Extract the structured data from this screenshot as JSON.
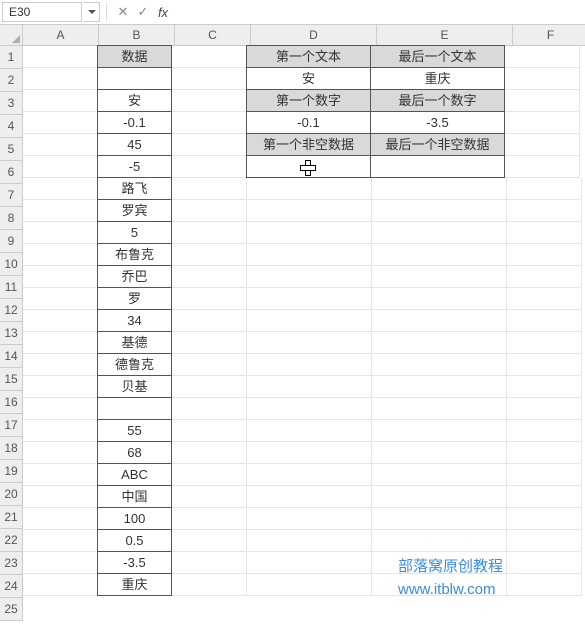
{
  "name_box": "E30",
  "formula_value": "",
  "columns": [
    "A",
    "B",
    "C",
    "D",
    "E",
    "F"
  ],
  "rows_count": 25,
  "col_B_header": "数据",
  "col_B": [
    "",
    "",
    "安",
    "-0.1",
    "45",
    "-5",
    "路飞",
    "罗宾",
    "5",
    "布鲁克",
    "乔巴",
    "罗",
    "34",
    "基德",
    "德鲁克",
    "贝基",
    "",
    "55",
    "68",
    "ABC",
    "中国",
    "100",
    "0.5",
    "-3.5",
    "重庆"
  ],
  "table2": {
    "r1c1": "第一个文本",
    "r1c2": "最后一个文本",
    "r2c1": "安",
    "r2c2": "重庆",
    "r3c1": "第一个数字",
    "r3c2": "最后一个数字",
    "r4c1": "-0.1",
    "r4c2": "-3.5",
    "r5c1": "第一个非空数据",
    "r5c2": "最后一个非空数据",
    "r6c1": "",
    "r6c2": ""
  },
  "watermark": {
    "line1": "部落窝原创教程",
    "line2": "www.itblw.com"
  },
  "fb_buttons": {
    "cancel": "✕",
    "confirm": "✓",
    "fx": "fx"
  }
}
